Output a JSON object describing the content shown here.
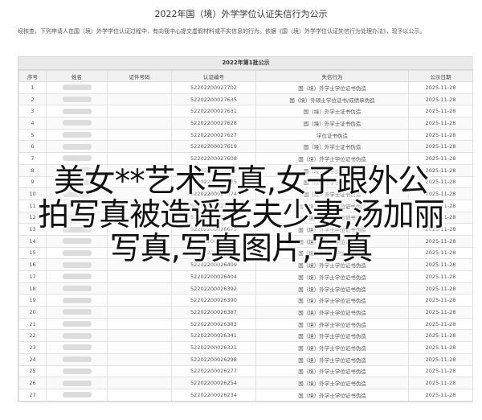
{
  "page": {
    "title": "2022年国（境）外学学位认证失信行为公示",
    "intro": "经核查，下列申请人在国（境）外学学位认证过程中，有向我中心提交虚假材料或不实信息的行为。依据《国（境）外学学位认证失信行为处理办法》，现予以公示。"
  },
  "table": {
    "caption": "2022年第1批公示",
    "headers": [
      "序号",
      "姓名",
      "证件号码",
      "认证编号",
      "失信行为",
      "公示日期"
    ],
    "rows": [
      [
        "1",
        "",
        "",
        "52202200027702",
        "国（境）外学士学位证书伪造",
        "2025-11-28"
      ],
      [
        "2",
        "",
        "",
        "52202200027635",
        "国（境）外硕士学位证书/成绩单伪造",
        "2025-11-28"
      ],
      [
        "3",
        "",
        "",
        "52202200027631",
        "国（境）外学士证书伪造",
        "2025-11-28"
      ],
      [
        "4",
        "",
        "",
        "52202200027628",
        "国（境）外学士证书伪造",
        "2025-11-28"
      ],
      [
        "5",
        "",
        "",
        "52202200027627",
        "学位证书伪造",
        "2025-11-28"
      ],
      [
        "6",
        "",
        "",
        "52202200027619",
        "国（境）外学士证书伪造",
        "2025-11-28"
      ],
      [
        "7",
        "",
        "",
        "52202200027608",
        "国（境）外学士学位证书伪造",
        "2025-11-28"
      ],
      [
        "8",
        "",
        "",
        "52202200027597",
        "国（境）外学士证书伪造",
        "2025-11-28"
      ],
      [
        "9",
        "",
        "",
        "52202200027585",
        "国（境）外学士证书伪造",
        "2025-11-28"
      ],
      [
        "10",
        "",
        "",
        "52202200027574",
        "国（境）外学士证书伪造",
        "2025-11-28"
      ],
      [
        "11",
        "",
        "",
        "52202200027560",
        "国（境）外学士学位证书伪造",
        "2025-11-28"
      ],
      [
        "12",
        "",
        "",
        "52202200026706",
        "国（境）外学士学位证书伪造",
        "2025-11-28"
      ],
      [
        "13",
        "",
        "",
        "52202200026675",
        "国（境）外学士学位证书伪造",
        "2025-11-28"
      ],
      [
        "14",
        "",
        "",
        "52202200026656",
        "国（境）外学士学位证书伪造",
        "2025-11-28"
      ],
      [
        "15",
        "",
        "",
        "52202200026450",
        "国（境）外学士学位证书伪造",
        "2025-11-28"
      ],
      [
        "16",
        "",
        "",
        "52202200026409",
        "国（境）外学士学位证书伪造",
        "2025-11-28"
      ],
      [
        "17",
        "",
        "",
        "52202200026404",
        "国（境）外学士学位证书伪造",
        "2025-11-28"
      ],
      [
        "18",
        "",
        "",
        "52202200026392",
        "国（境）外学士学位证书伪造",
        "2025-11-28"
      ],
      [
        "19",
        "",
        "",
        "52202200026390",
        "国（境）外学士学位证书伪造",
        "2025-11-28"
      ],
      [
        "20",
        "",
        "",
        "52202200026387",
        "国（境）外学士学位证书伪造",
        "2025-11-28"
      ],
      [
        "21",
        "",
        "",
        "52202200026383",
        "国（境）外学士学位证书伪造",
        "2025-11-28"
      ],
      [
        "22",
        "",
        "",
        "52202200026341",
        "国（境）外学士学位证书伪造",
        "2025-11-28"
      ],
      [
        "23",
        "",
        "",
        "52202200026321",
        "国（境）外学士学位证书伪造",
        "2025-11-28"
      ],
      [
        "24",
        "",
        "",
        "52202200026298",
        "国（境）外学士学位证书伪造",
        "2025-11-28"
      ],
      [
        "25",
        "",
        "",
        "52202200026277",
        "国（境）外学士学位证书伪造",
        "2025-11-28"
      ],
      [
        "26",
        "",
        "",
        "52202200026254",
        "国（境）外学士学位证书伪造",
        "2025-11-28"
      ],
      [
        "27",
        "",
        "",
        "52202200026234",
        "国（境）外学士学位证书伪造",
        "2025-11-28"
      ]
    ]
  },
  "overlay": {
    "lines": [
      "美女**艺术写真,女子跟外公",
      "拍写真被造谣老夫少妻,汤加丽",
      "写真,写真图片,写真"
    ]
  }
}
